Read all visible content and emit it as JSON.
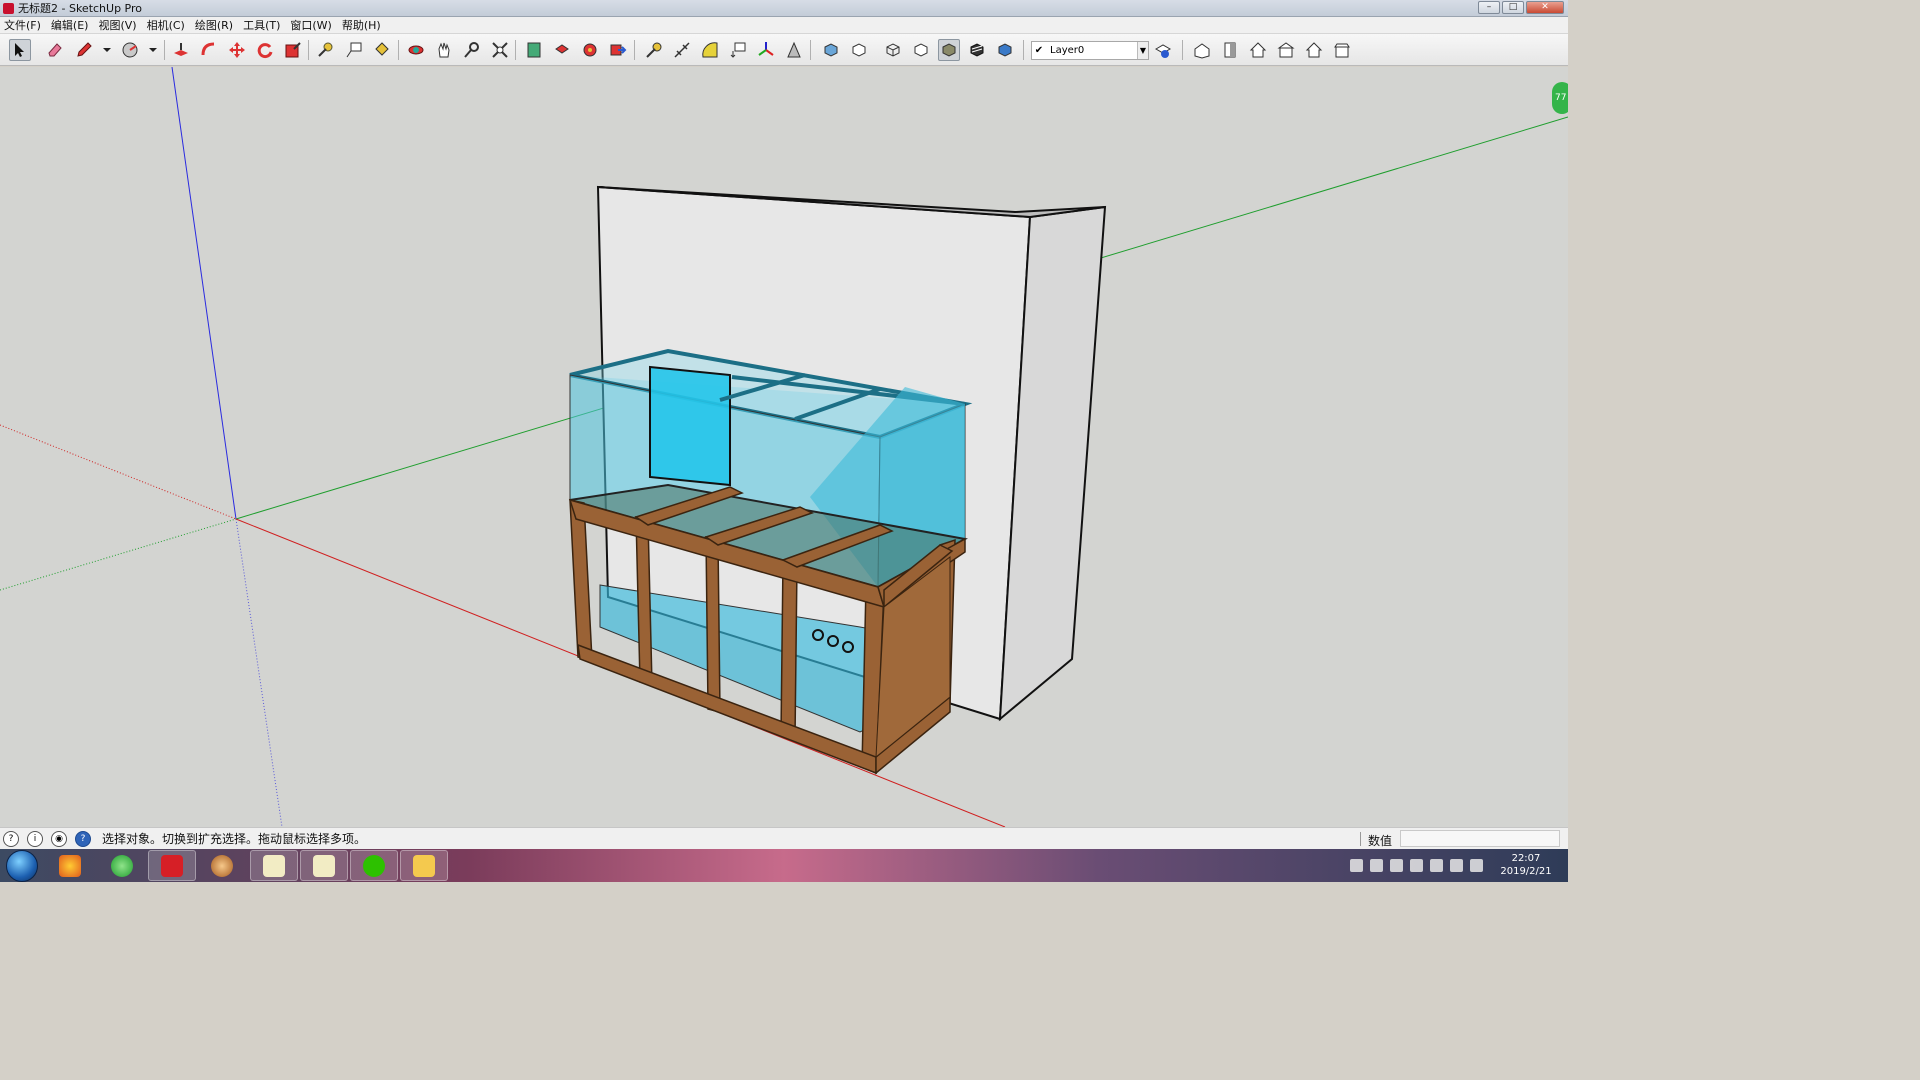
{
  "window": {
    "title": "无标题2 - SketchUp Pro",
    "controls": {
      "minimize": "–",
      "maximize": "□",
      "close": "✕"
    }
  },
  "menu": {
    "items": [
      "文件(F)",
      "编辑(E)",
      "视图(V)",
      "相机(C)",
      "绘图(R)",
      "工具(T)",
      "窗口(W)",
      "帮助(H)"
    ]
  },
  "toolbar": {
    "icons": [
      "select-icon",
      "eraser-icon",
      "pencil-icon",
      "pencil-dropdown-icon",
      "circle-icon",
      "circle-dropdown-icon",
      "push-pull-icon",
      "follow-me-icon",
      "move-icon",
      "rotate-icon",
      "scale-icon",
      "tape-measure-icon",
      "text-icon",
      "paint-bucket-icon",
      "orbit-icon",
      "pan-icon",
      "zoom-icon",
      "zoom-extents-icon",
      "warehouse-icon",
      "components-icon",
      "extension-icon",
      "share-icon",
      "tape-icon",
      "dimension-icon",
      "protractor-icon",
      "3d-text-icon",
      "axes-icon",
      "section-plane-icon",
      "xray-icon",
      "back-edges-icon",
      "wireframe-icon",
      "hidden-line-icon",
      "shaded-icon",
      "shaded-textures-icon",
      "monochrome-icon",
      "layer-manager-icon",
      "iso-view-icon",
      "top-view-icon",
      "front-view-icon",
      "right-view-icon",
      "back-view-icon",
      "left-view-icon"
    ],
    "active_icon": "shaded-icon",
    "layer": {
      "checked": "✔",
      "name": "Layer0"
    }
  },
  "viewport": {
    "badge": "77",
    "scene_colors": {
      "background": "#d3d4d1",
      "wall_front": "#e6e6e6",
      "wall_side": "#d9d9d9",
      "glass": "#4fc5e0",
      "frame": "#9a6235",
      "axis_red": "#d02020",
      "axis_green": "#1f9e2e",
      "axis_blue": "#2a2ae0"
    }
  },
  "statusbar": {
    "message": "选择对象。切换到扩充选择。拖动鼠标选择多项。",
    "measure_label": "数值",
    "measure_value": ""
  },
  "taskbar": {
    "clock_time": "22:07",
    "clock_date": "2019/2/21"
  }
}
